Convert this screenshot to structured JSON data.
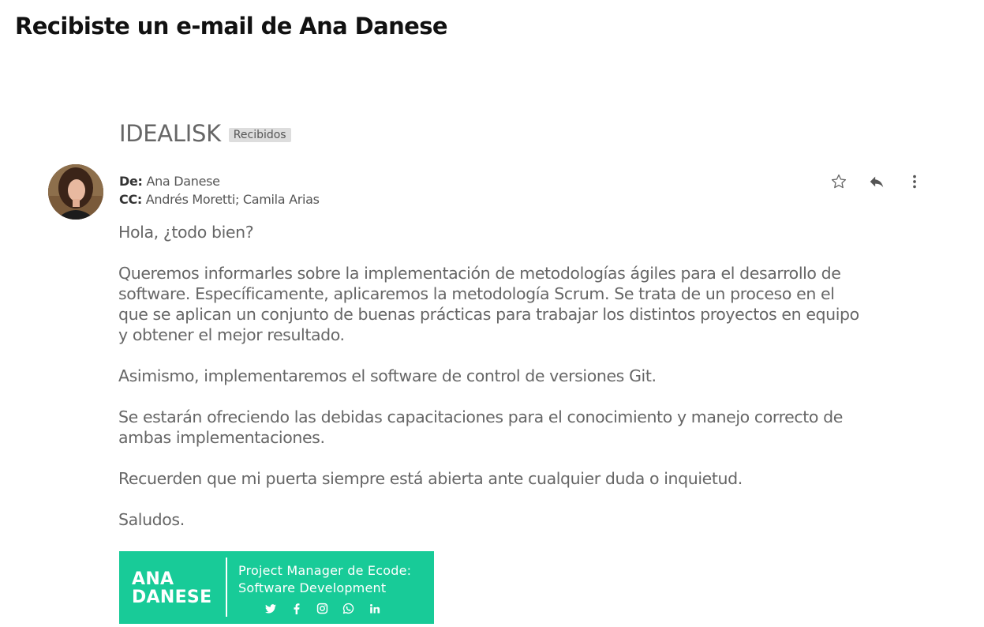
{
  "page": {
    "heading": "Recibiste un e-mail de Ana Danese"
  },
  "email": {
    "subject": "IDEALISK",
    "label": "Recibidos",
    "from_label": "De:",
    "from": "Ana Danese",
    "cc_label": "CC:",
    "cc": "Andrés Moretti; Camila Arias",
    "actions": [
      {
        "icon": "star-icon"
      },
      {
        "icon": "reply-icon"
      },
      {
        "icon": "more-vertical-icon"
      }
    ],
    "greeting": "Hola, ¿todo bien?",
    "paragraphs": [
      "Queremos informarles sobre la implementación de metodologías ágiles para el  desarrollo de software. Específicamente, aplicaremos la metodología Scrum. Se trata de un proceso en el que se aplican un conjunto de buenas prácticas para trabajar los distintos proyectos en equipo y obtener el mejor resultado.",
      "Asimismo, implementaremos el software de control de versiones Git.",
      "Se estarán ofreciendo las debidas capacitaciones para el conocimiento y manejo correcto de ambas implementaciones.",
      "Recuerden que mi puerta siempre está abierta ante cualquier duda o inquietud."
    ],
    "closing": "Saludos."
  },
  "signature": {
    "name_line1": "ANA",
    "name_line2": "DANESE",
    "role_line1": "Project Manager de Ecode:",
    "role_line2": "Software Development",
    "bg_color": "#18cb98",
    "social": [
      "twitter-icon",
      "facebook-icon",
      "instagram-icon",
      "whatsapp-icon",
      "linkedin-icon"
    ]
  }
}
